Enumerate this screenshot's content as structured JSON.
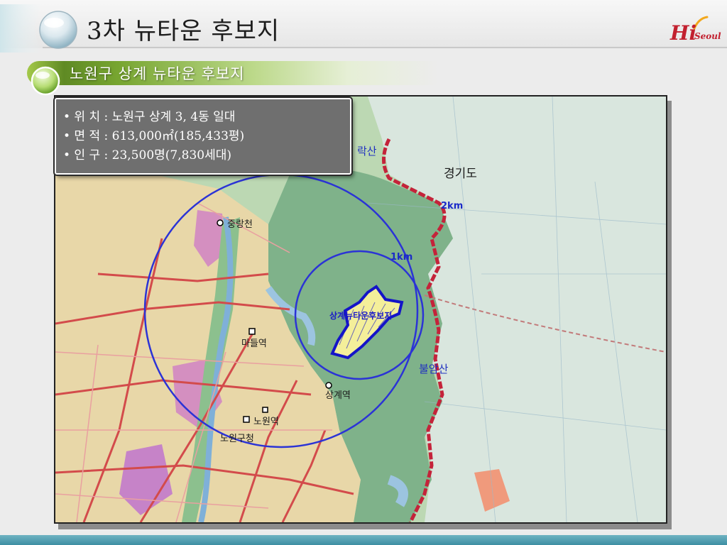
{
  "header": {
    "title": "3차 뉴타운 후보지",
    "logo": {
      "hi": "Hi",
      "seoul": "Seoul"
    }
  },
  "section": {
    "subtitle": "노원구 상계 뉴타운 후보지"
  },
  "info": {
    "location": "• 위 치 : 노원구 상계 3, 4동  일대",
    "area": "• 면 적 : 613,000㎡(185,433평)",
    "population": "• 인 구 : 23,500명(7,830세대)"
  },
  "map": {
    "labels": {
      "gyeonggi": "경기도",
      "ring_2km": "2km",
      "ring_1km": "1km",
      "candidate_site": "상계뉴타운후보지",
      "buramsan": "불암산",
      "suraksan": "락산",
      "junghwacheon": "중랑천",
      "madeul_station": "마들역",
      "sanggye_station": "상계역",
      "nowon_station": "노원역",
      "nowon_office": "노원구청"
    },
    "colors": {
      "ring": "#2b33d6",
      "boundary": "#c4233a",
      "site_fill": "#f4ef9a",
      "site_outline": "#1414c8"
    }
  }
}
